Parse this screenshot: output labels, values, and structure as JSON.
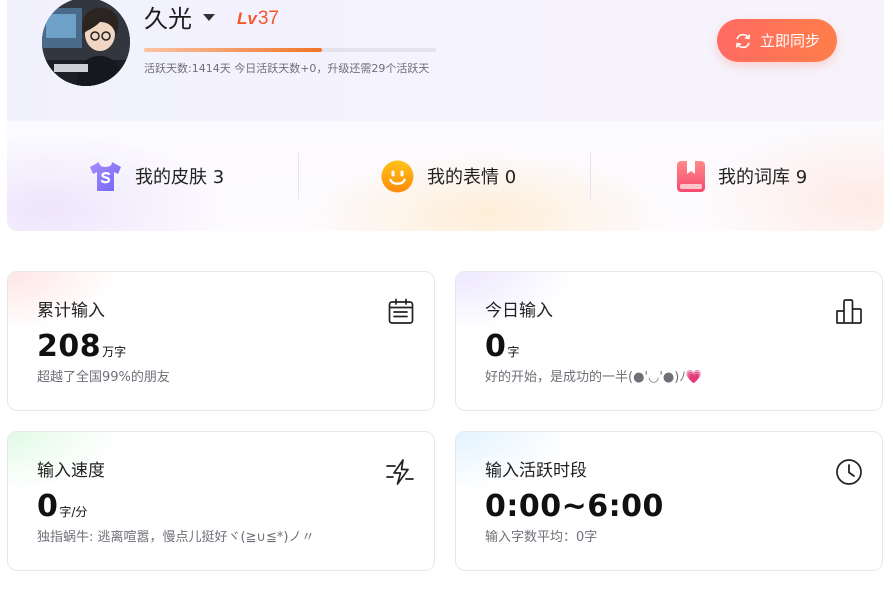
{
  "profile": {
    "username": "久光",
    "level_prefix": "Lv",
    "level_number": "37",
    "level_progress": 0.61,
    "activity_text": "活跃天数:1414天 今日活跃天数+0，升级还需29个活跃天"
  },
  "sync_button": {
    "label": "立即同步",
    "icon": "sync-icon"
  },
  "shortcuts": [
    {
      "label": "我的皮肤 3",
      "icon": "tshirt-icon",
      "color": "#8f7cf6"
    },
    {
      "label": "我的表情 0",
      "icon": "smiley-icon",
      "color": "#ffa613"
    },
    {
      "label": "我的词库 9",
      "icon": "bookmark-icon",
      "color": "#f95f75"
    }
  ],
  "cards": [
    {
      "title": "累计输入",
      "value": "208",
      "unit": "万字",
      "note": "超越了全国99%的朋友",
      "icon": "calendar-icon"
    },
    {
      "title": "今日输入",
      "value": "0",
      "unit": "字",
      "note": "好的开始，是成功的一半(●'◡'●)ﾉ💗",
      "icon": "bar-chart-icon"
    },
    {
      "title": "输入速度",
      "value": "0",
      "unit": "字/分",
      "note": "独指蜗牛: 逃离喧嚣，慢点儿挺好ヾ(≧∪≦*)ノ〃",
      "icon": "speed-lightning-icon"
    },
    {
      "title": "输入活跃时段",
      "value": "0:00~6:00",
      "unit": "",
      "note": "输入字数平均：0字",
      "icon": "clock-icon"
    }
  ],
  "colors": {
    "accent_orange": "#f5572b",
    "sync_gradient_start": "#ff6a63",
    "sync_gradient_end": "#ff7e4a",
    "text_muted": "#6f6f78"
  }
}
